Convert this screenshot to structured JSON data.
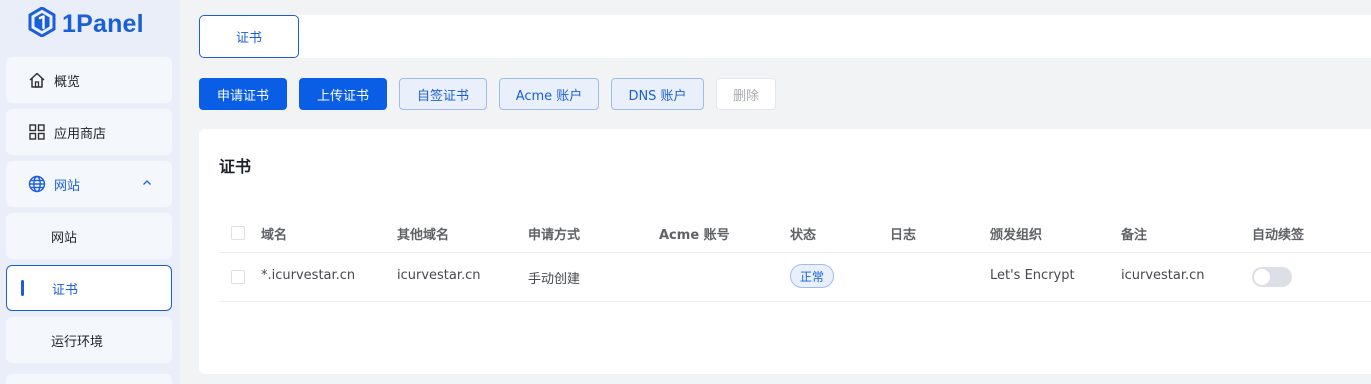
{
  "app": {
    "logo_text": "1Panel"
  },
  "sidebar": {
    "items": [
      {
        "label": "概览",
        "icon": "home-icon"
      },
      {
        "label": "应用商店",
        "icon": "apps-grid-icon"
      },
      {
        "label": "网站",
        "icon": "globe-icon",
        "expanded": true
      }
    ],
    "subitems": [
      {
        "label": "网站"
      },
      {
        "label": "证书",
        "active": true
      },
      {
        "label": "运行环境"
      }
    ]
  },
  "tabs": [
    {
      "label": "证书",
      "active": true
    }
  ],
  "toolbar": {
    "apply_cert": "申请证书",
    "upload_cert": "上传证书",
    "self_signed": "自签证书",
    "acme_account": "Acme 账户",
    "dns_account": "DNS 账户",
    "delete": "删除"
  },
  "card": {
    "title": "证书"
  },
  "table": {
    "headers": {
      "domain": "域名",
      "other_domains": "其他域名",
      "apply_method": "申请方式",
      "acme_account": "Acme 账号",
      "status": "状态",
      "log": "日志",
      "issuer": "颁发组织",
      "remark": "备注",
      "auto_renew": "自动续签"
    },
    "rows": [
      {
        "domain": "*.icurvestar.cn",
        "other_domains": "icurvestar.cn",
        "apply_method": "手动创建",
        "acme_account": "",
        "status": "正常",
        "log": "",
        "issuer": "Let's Encrypt",
        "remark": "icurvestar.cn",
        "auto_renew": false
      }
    ]
  },
  "colors": {
    "primary": "#0a5ee6",
    "accent": "#1a5fd8",
    "sidebar_bg": "#e9eef8",
    "page_bg": "#f2f3f5"
  }
}
